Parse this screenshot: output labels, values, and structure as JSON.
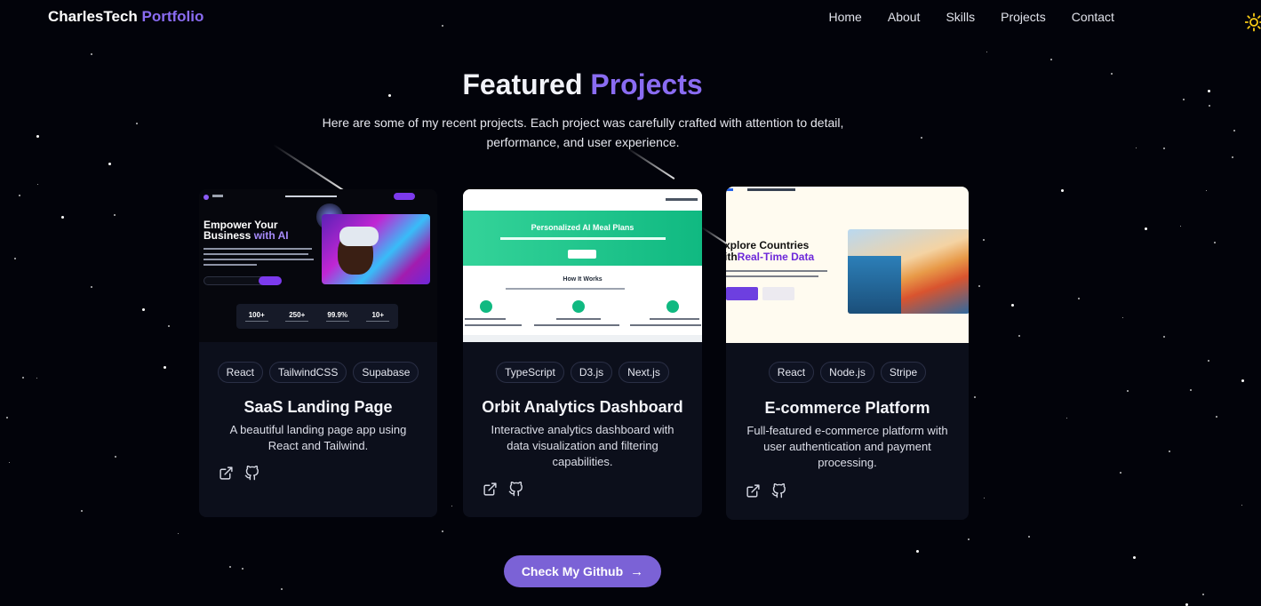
{
  "site": {
    "logo_main": "CharlesTech",
    "logo_accent": "Portfolio"
  },
  "nav": {
    "items": [
      "Home",
      "About",
      "Skills",
      "Projects",
      "Contact"
    ],
    "theme_toggle_icon": "sun-icon"
  },
  "section": {
    "title_main": "Featured",
    "title_accent": "Projects",
    "intro": "Here are some of my recent projects. Each project was carefully crafted with attention to detail, performance, and user experience."
  },
  "projects": [
    {
      "title": "SaaS Landing Page",
      "description": "A beautiful landing page app using React and Tailwind.",
      "tags": [
        "React",
        "TailwindCSS",
        "Supabase"
      ],
      "thumbnail": {
        "hero_heading_line1": "Empower Your",
        "hero_heading_line2_plain": "Business",
        "hero_heading_line2_accent": "with AI",
        "stats": [
          "100+",
          "250+",
          "99.9%",
          "10+"
        ]
      }
    },
    {
      "title": "Orbit Analytics Dashboard",
      "description": "Interactive analytics dashboard with data visualization and filtering capabilities.",
      "tags": [
        "TypeScript",
        "D3.js",
        "Next.js"
      ],
      "thumbnail": {
        "banner_heading": "Personalized AI Meal Plans",
        "section_heading": "How It Works"
      }
    },
    {
      "title": "E-commerce Platform",
      "description": "Full-featured e-commerce platform with user authentication and payment processing.",
      "tags": [
        "React",
        "Node.js",
        "Stripe"
      ],
      "thumbnail": {
        "heading_line1": "xplore Countries",
        "heading_line2_plain": "ith",
        "heading_line2_accent": "Real-Time Data"
      }
    }
  ],
  "card_links": {
    "demo_icon": "external-link-icon",
    "code_icon": "github-icon"
  },
  "cta": {
    "label": "Check My Github",
    "icon": "arrow-right-icon"
  },
  "colors": {
    "background": "#02030a",
    "accent": "#8a6cf2",
    "card": "#0c0f1b",
    "button": "#7b62d6"
  }
}
